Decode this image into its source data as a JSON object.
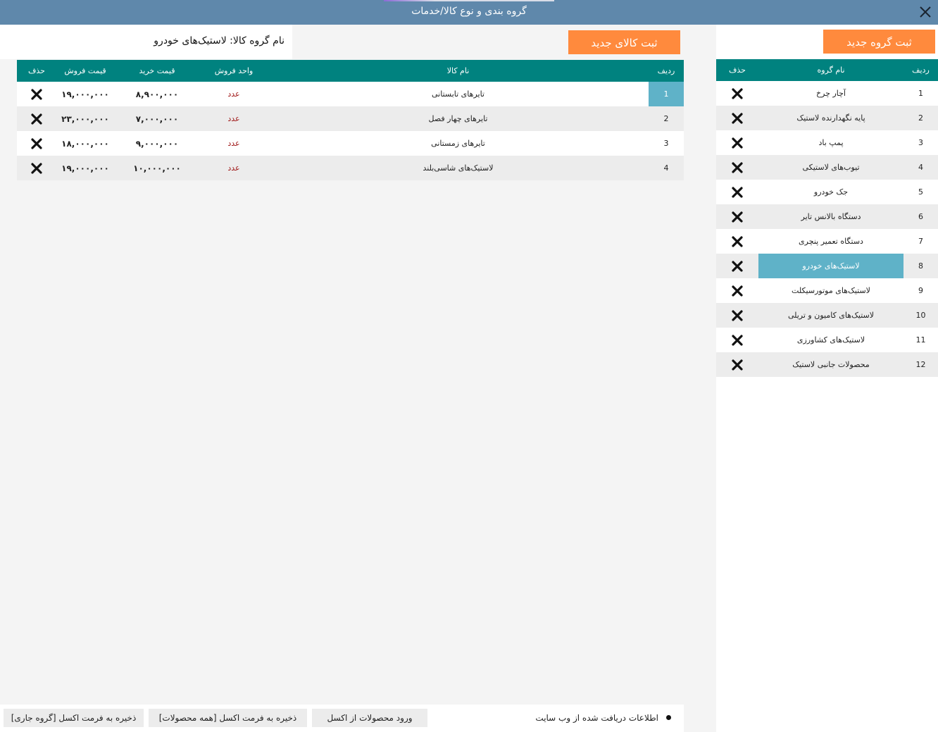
{
  "window": {
    "title": "گروه بندی و نوع کالا/خدمات",
    "close_icon": "close-icon"
  },
  "products_panel": {
    "add_button": "ثبت کالای جدید",
    "group_label": "نام گروه کالا: لاستیک‌های خودرو",
    "columns": [
      "ردیف",
      "نام کالا",
      "واحد فروش",
      "قیمت خرید",
      "قیمت فروش",
      "حذف"
    ],
    "rows": [
      {
        "index": "1",
        "name": "تایرهای تابستانی",
        "unit": "عدد",
        "buy": "۸,۹۰۰,۰۰۰",
        "sell": "۱۹,۰۰۰,۰۰۰",
        "selected": true
      },
      {
        "index": "2",
        "name": "تایرهای چهار فصل",
        "unit": "عدد",
        "buy": "۷,۰۰۰,۰۰۰",
        "sell": "۲۳,۰۰۰,۰۰۰",
        "selected": false
      },
      {
        "index": "3",
        "name": "تایرهای زمستانی",
        "unit": "عدد",
        "buy": "۹,۰۰۰,۰۰۰",
        "sell": "۱۸,۰۰۰,۰۰۰",
        "selected": false
      },
      {
        "index": "4",
        "name": "لاستیک‌های شاسی‌بلند",
        "unit": "عدد",
        "buy": "۱۰,۰۰۰,۰۰۰",
        "sell": "۱۹,۰۰۰,۰۰۰",
        "selected": false
      }
    ]
  },
  "groups_panel": {
    "add_button": "ثبت گروه جدید",
    "columns": [
      "ردیف",
      "نام گروه",
      "حذف"
    ],
    "rows": [
      {
        "index": "1",
        "name": "آچار چرخ",
        "selected": false
      },
      {
        "index": "2",
        "name": "پایه نگهدارنده لاستیک",
        "selected": false
      },
      {
        "index": "3",
        "name": "پمپ باد",
        "selected": false
      },
      {
        "index": "4",
        "name": "تیوب‌های لاستیکی",
        "selected": false
      },
      {
        "index": "5",
        "name": "جک خودرو",
        "selected": false
      },
      {
        "index": "6",
        "name": "دستگاه بالانس تایر",
        "selected": false
      },
      {
        "index": "7",
        "name": "دستگاه تعمیر پنچری",
        "selected": false
      },
      {
        "index": "8",
        "name": "لاستیک‌های خودرو",
        "selected": true
      },
      {
        "index": "9",
        "name": "لاستیک‌های موتورسیکلت",
        "selected": false
      },
      {
        "index": "10",
        "name": "لاستیک‌های کامیون و تریلی",
        "selected": false
      },
      {
        "index": "11",
        "name": "لاستیک‌های کشاورزی",
        "selected": false
      },
      {
        "index": "12",
        "name": "محصولات جانبی لاستیک",
        "selected": false
      }
    ]
  },
  "bottom": {
    "save_current_group": "ذخیره به فرمت اکسل [گروه جاری]",
    "save_all_products": "ذخیره به فرمت اکسل [همه محصولات]",
    "import_excel": "ورود محصولات از اکسل",
    "status": "اطلاعات دریافت شده از وب سایت"
  },
  "colors": {
    "titlebar": "#5f88ab",
    "header": "#00827f",
    "orange": "#ff8a3d",
    "selected": "#5fb2c8",
    "unit_text": "#a01818"
  }
}
